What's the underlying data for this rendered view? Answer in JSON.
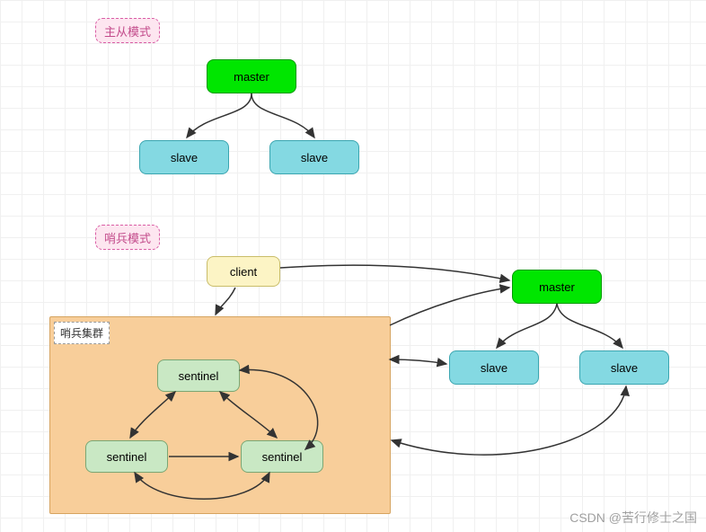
{
  "titles": {
    "master_slave_mode": "主从模式",
    "sentinel_mode": "哨兵模式",
    "sentinel_cluster": "哨兵集群"
  },
  "nodes": {
    "master1": "master",
    "slave1a": "slave",
    "slave1b": "slave",
    "client": "client",
    "master2": "master",
    "slave2a": "slave",
    "slave2b": "slave",
    "sentinel1": "sentinel",
    "sentinel2": "sentinel",
    "sentinel3": "sentinel"
  },
  "watermark": "CSDN @苦行修士之国",
  "colors": {
    "master": "#00e600",
    "slave": "#84d9e2",
    "client": "#fcf4c5",
    "sentinel": "#c9e8c4",
    "pink": "#fde6f0",
    "cluster": "#f8ce9a"
  }
}
